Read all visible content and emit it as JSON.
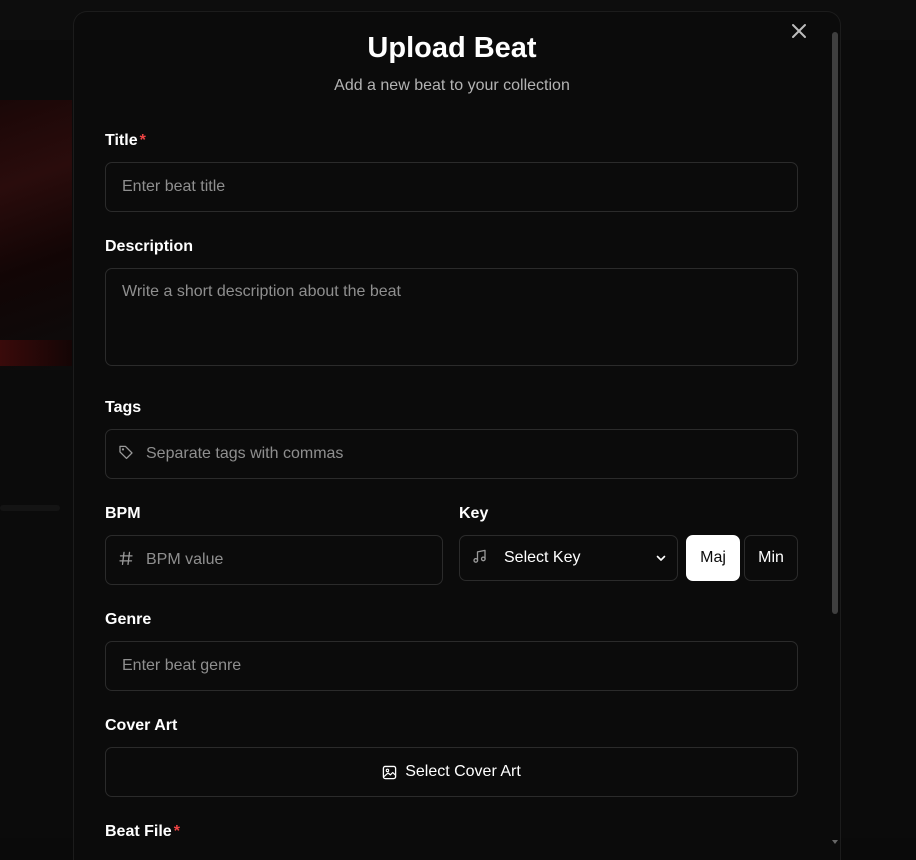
{
  "background": {
    "top_left_text": "...",
    "mid_text": "..."
  },
  "modal": {
    "title": "Upload Beat",
    "subtitle": "Add a new beat to your collection",
    "close_icon": "close-icon"
  },
  "form": {
    "title": {
      "label": "Title",
      "required_mark": "*",
      "placeholder": "Enter beat title"
    },
    "description": {
      "label": "Description",
      "placeholder": "Write a short description about the beat"
    },
    "tags": {
      "label": "Tags",
      "placeholder": "Separate tags with commas",
      "icon": "tag-icon"
    },
    "bpm": {
      "label": "BPM",
      "placeholder": "BPM value",
      "icon": "hash-icon"
    },
    "key": {
      "label": "Key",
      "selected": "Select Key",
      "icon": "music-note-icon",
      "major_label": "Maj",
      "minor_label": "Min",
      "active_mode": "Maj"
    },
    "genre": {
      "label": "Genre",
      "placeholder": "Enter beat genre"
    },
    "cover_art": {
      "label": "Cover Art",
      "button_label": "Select Cover Art",
      "icon": "image-icon"
    },
    "beat_file": {
      "label": "Beat File",
      "required_mark": "*"
    }
  },
  "colors": {
    "background": "#0b0b0b",
    "border": "#2b2b2b",
    "required": "#ef4444",
    "placeholder": "#8f8f8f",
    "active_toggle": "#ffffff"
  }
}
